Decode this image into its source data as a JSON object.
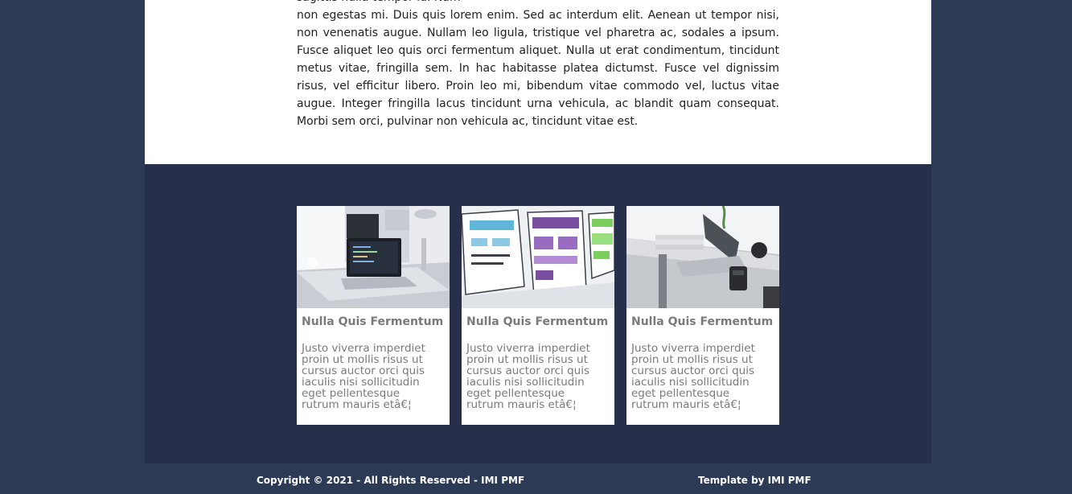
{
  "article": {
    "partial_line": "sagittis nulla tempor id. Nam",
    "paragraph": "non egestas mi. Duis quis lorem enim. Sed ac interdum elit. Aenean ut tempor nisi, non venenatis augue. Nullam leo ligula, tristique vel pharetra ac, sodales a ipsum. Fusce aliquet leo quis orci fermentum aliquet. Nulla ut erat condimentum, tincidunt metus vitae, fringilla sem. In hac habitasse platea dictumst. Fusce vel dignissim risus, vel efficitur libero. Proin leo mi, bibendum vitae commodo vel, luctus vitae augue. Integer fringilla lacus tincidunt urna vehicula, ac blandit quam consequat. Morbi sem orci, pulvinar non vehicula ac, tincidunt vitae est."
  },
  "cards": [
    {
      "title": "Nulla Quis Fermentum",
      "text": "Justo viverra imperdiet proin ut mollis risus ut cursus auctor orci quis iaculis nisi sollicitudin eget pellentesque rutrum mauris etâ€¦",
      "image": "laptop-desk-photo"
    },
    {
      "title": "Nulla Quis Fermentum",
      "text": "Justo viverra imperdiet proin ut mollis risus ut cursus auctor orci quis iaculis nisi sollicitudin eget pellentesque rutrum mauris etâ€¦",
      "image": "wireframe-sketch-photo"
    },
    {
      "title": "Nulla Quis Fermentum",
      "text": "Justo viverra imperdiet proin ut mollis risus ut cursus auctor orci quis iaculis nisi sollicitudin eget pellentesque rutrum mauris etâ€¦",
      "image": "workspace-laptop-photo"
    }
  ],
  "footer": {
    "copyright": "Copyright © 2021 - All Rights Reserved - IMI PMF",
    "credit": "Template by IMI PMF"
  },
  "colors": {
    "page_bg": "#2d3a55",
    "cards_band_bg": "#27304a",
    "card_text": "#7a7a7a"
  }
}
